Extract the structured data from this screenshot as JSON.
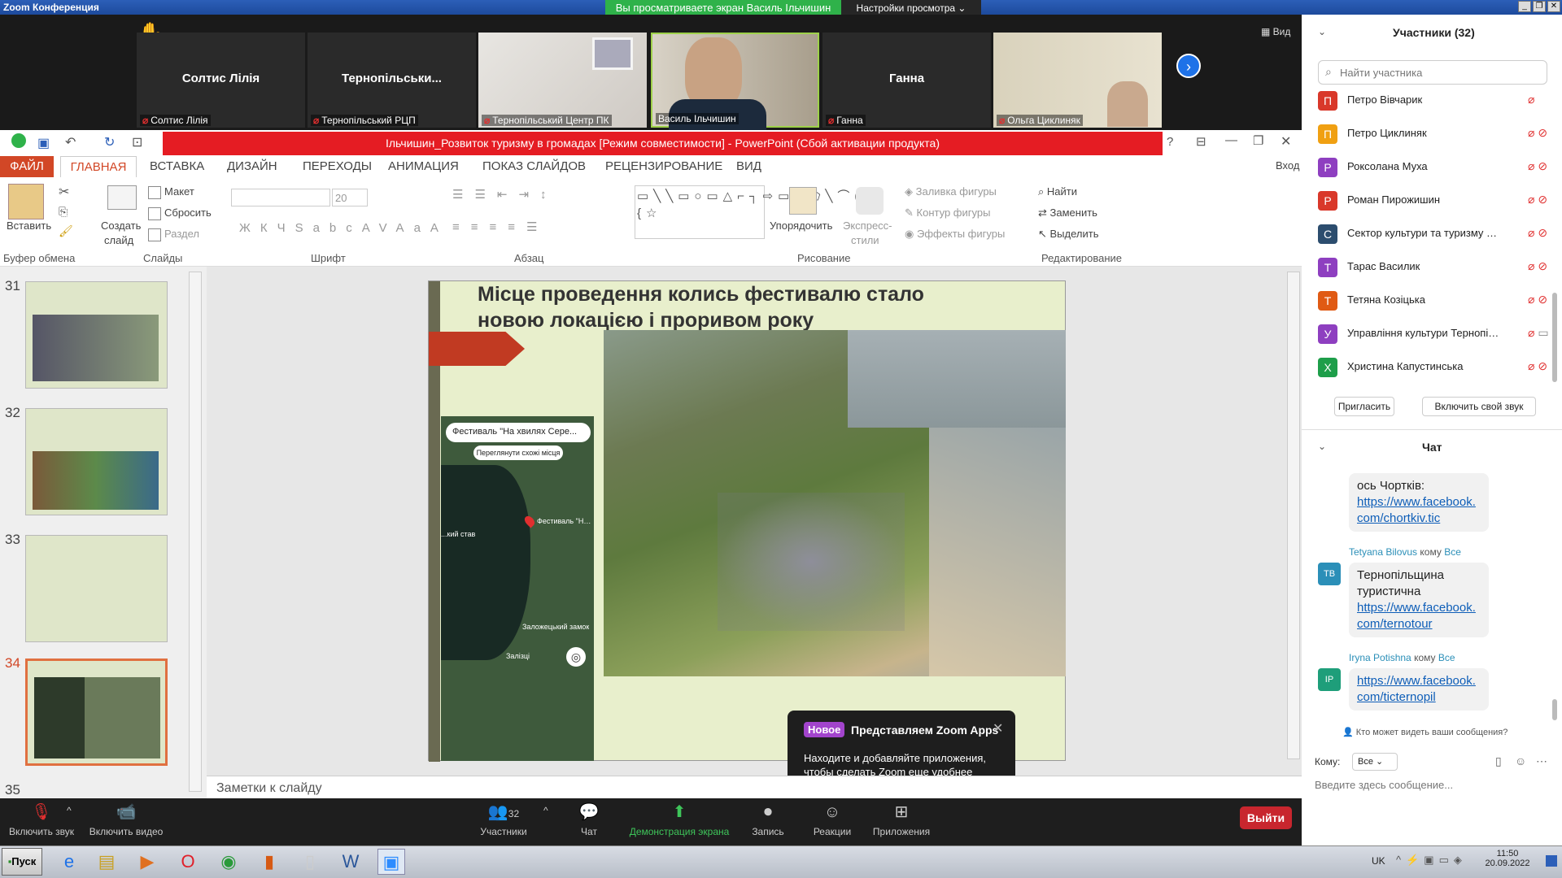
{
  "window": {
    "title": "Zoom Конференция"
  },
  "banner": {
    "viewing": "Вы просматриваете экран Василь Ільчишин",
    "view_options": "Настройки просмотра"
  },
  "gallery": {
    "view_label": "Вид",
    "tiles": [
      {
        "name": "Солтис Лілія",
        "label": "Солтис Лілія"
      },
      {
        "name": "Тернопільськи...",
        "label": "Тернопільський РЦП"
      },
      {
        "name": "",
        "label": "Тернопільський Центр ПК"
      },
      {
        "name": "",
        "label": "Василь Ільчишин"
      },
      {
        "name": "Ганна",
        "label": "Ганна"
      },
      {
        "name": "",
        "label": "Ольга Циклиняк"
      }
    ]
  },
  "ppt": {
    "title": "Ільчишин_Розвиток туризму в громадах [Режим совместимости] -  PowerPoint (Сбой активации продукта)",
    "login": "Вход",
    "tabs": [
      "ФАЙЛ",
      "ГЛАВНАЯ",
      "ВСТАВКА",
      "ДИЗАЙН",
      "ПЕРЕХОДЫ",
      "АНИМАЦИЯ",
      "ПОКАЗ СЛАЙДОВ",
      "РЕЦЕНЗИРОВАНИЕ",
      "ВИД"
    ],
    "ribbon": {
      "paste": "Вставить",
      "new_slide_1": "Создать",
      "new_slide_2": "слайд",
      "layout": "Макет",
      "reset": "Сбросить",
      "section": "Раздел",
      "font_size": "20",
      "arrange": "Упорядочить",
      "quick_1": "Экспресс-",
      "quick_2": "стили",
      "fill": "Заливка фигуры",
      "outline": "Контур фигуры",
      "effects": "Эффекты фигуры",
      "find": "Найти",
      "replace": "Заменить",
      "select": "Выделить",
      "groups": [
        "Буфер обмена",
        "Слайды",
        "Шрифт",
        "Абзац",
        "Рисование",
        "Редактирование"
      ]
    },
    "thumbnails": [
      {
        "num": "31"
      },
      {
        "num": "32"
      },
      {
        "num": "33"
      },
      {
        "num": "34"
      },
      {
        "num": "35"
      }
    ],
    "slide": {
      "title": "Місце проведення колись фестивалю стало новою локацією і проривом року",
      "map_search": "Фестиваль \"На хвилях Сере...",
      "map_similar": "Переглянути схожі місця",
      "map_pin": "Фестиваль \"На хвилях Сере...",
      "map_lake": "...кий став",
      "map_castle": "Заложецький замок",
      "map_town": "Залізці"
    },
    "notes": "Заметки к слайду"
  },
  "popup": {
    "badge": "Новое",
    "title": "Представляем Zoom Apps",
    "text": "Находите и добавляйте приложения, чтобы сделать Zoom еще удобнее"
  },
  "toolbar": {
    "mute": "Включить звук",
    "video": "Включить видео",
    "participants": "Участники",
    "participants_count": "32",
    "chat": "Чат",
    "share": "Демонстрация экрана",
    "record": "Запись",
    "reactions": "Реакции",
    "apps": "Приложения",
    "leave": "Выйти"
  },
  "participants": {
    "header": "Участники (32)",
    "search_placeholder": "Найти участника",
    "list": [
      {
        "initial": "П",
        "name": "Петро Вівчарик",
        "color": "#d9382a"
      },
      {
        "initial": "П",
        "name": "Петро Циклиняк",
        "color": "#f0a012"
      },
      {
        "initial": "Р",
        "name": "Роксолана Муха",
        "color": "#8e3fc0"
      },
      {
        "initial": "Р",
        "name": "Роман Пирожишин",
        "color": "#d9382a"
      },
      {
        "initial": "С",
        "name": "Сектор культури та туризму Б...",
        "color": "#2c4d6e"
      },
      {
        "initial": "Т",
        "name": "Тарас Василик",
        "color": "#8e3fc0"
      },
      {
        "initial": "Т",
        "name": "Тетяна Козіцька",
        "color": "#e05a14"
      },
      {
        "initial": "У",
        "name": "Управління культури Тернопіл...",
        "color": "#8e3fc0"
      },
      {
        "initial": "Х",
        "name": "Христина Капустинська",
        "color": "#1e9e4a"
      }
    ],
    "invite": "Пригласить",
    "unmute_me": "Включить свой звук"
  },
  "chat": {
    "header": "Чат",
    "msg1_text": "ось Чортків:",
    "msg1_link": "https://www.facebook.com/chortkiv.tic",
    "msg2_sender": "Tetyana Bilovus",
    "msg2_to": "кому",
    "msg2_target": "Все",
    "msg2_initials": "ТВ",
    "msg2_text": "Тернопільщина туристична",
    "msg2_link": "https://www.facebook.com/ternotour",
    "msg3_sender": "Iryna Potishna",
    "msg3_to": "кому",
    "msg3_target": "Все",
    "msg3_initials": "IP",
    "msg3_link": "https://www.facebook.com/ticternopil",
    "who_sees": "Кто может видеть ваши сообщения?",
    "to_label": "Кому:",
    "to_value": "Все",
    "input_placeholder": "Введите здесь сообщение..."
  },
  "taskbar": {
    "start": "Пуск",
    "lang": "UK",
    "time": "11:50",
    "date": "20.09.2022"
  }
}
